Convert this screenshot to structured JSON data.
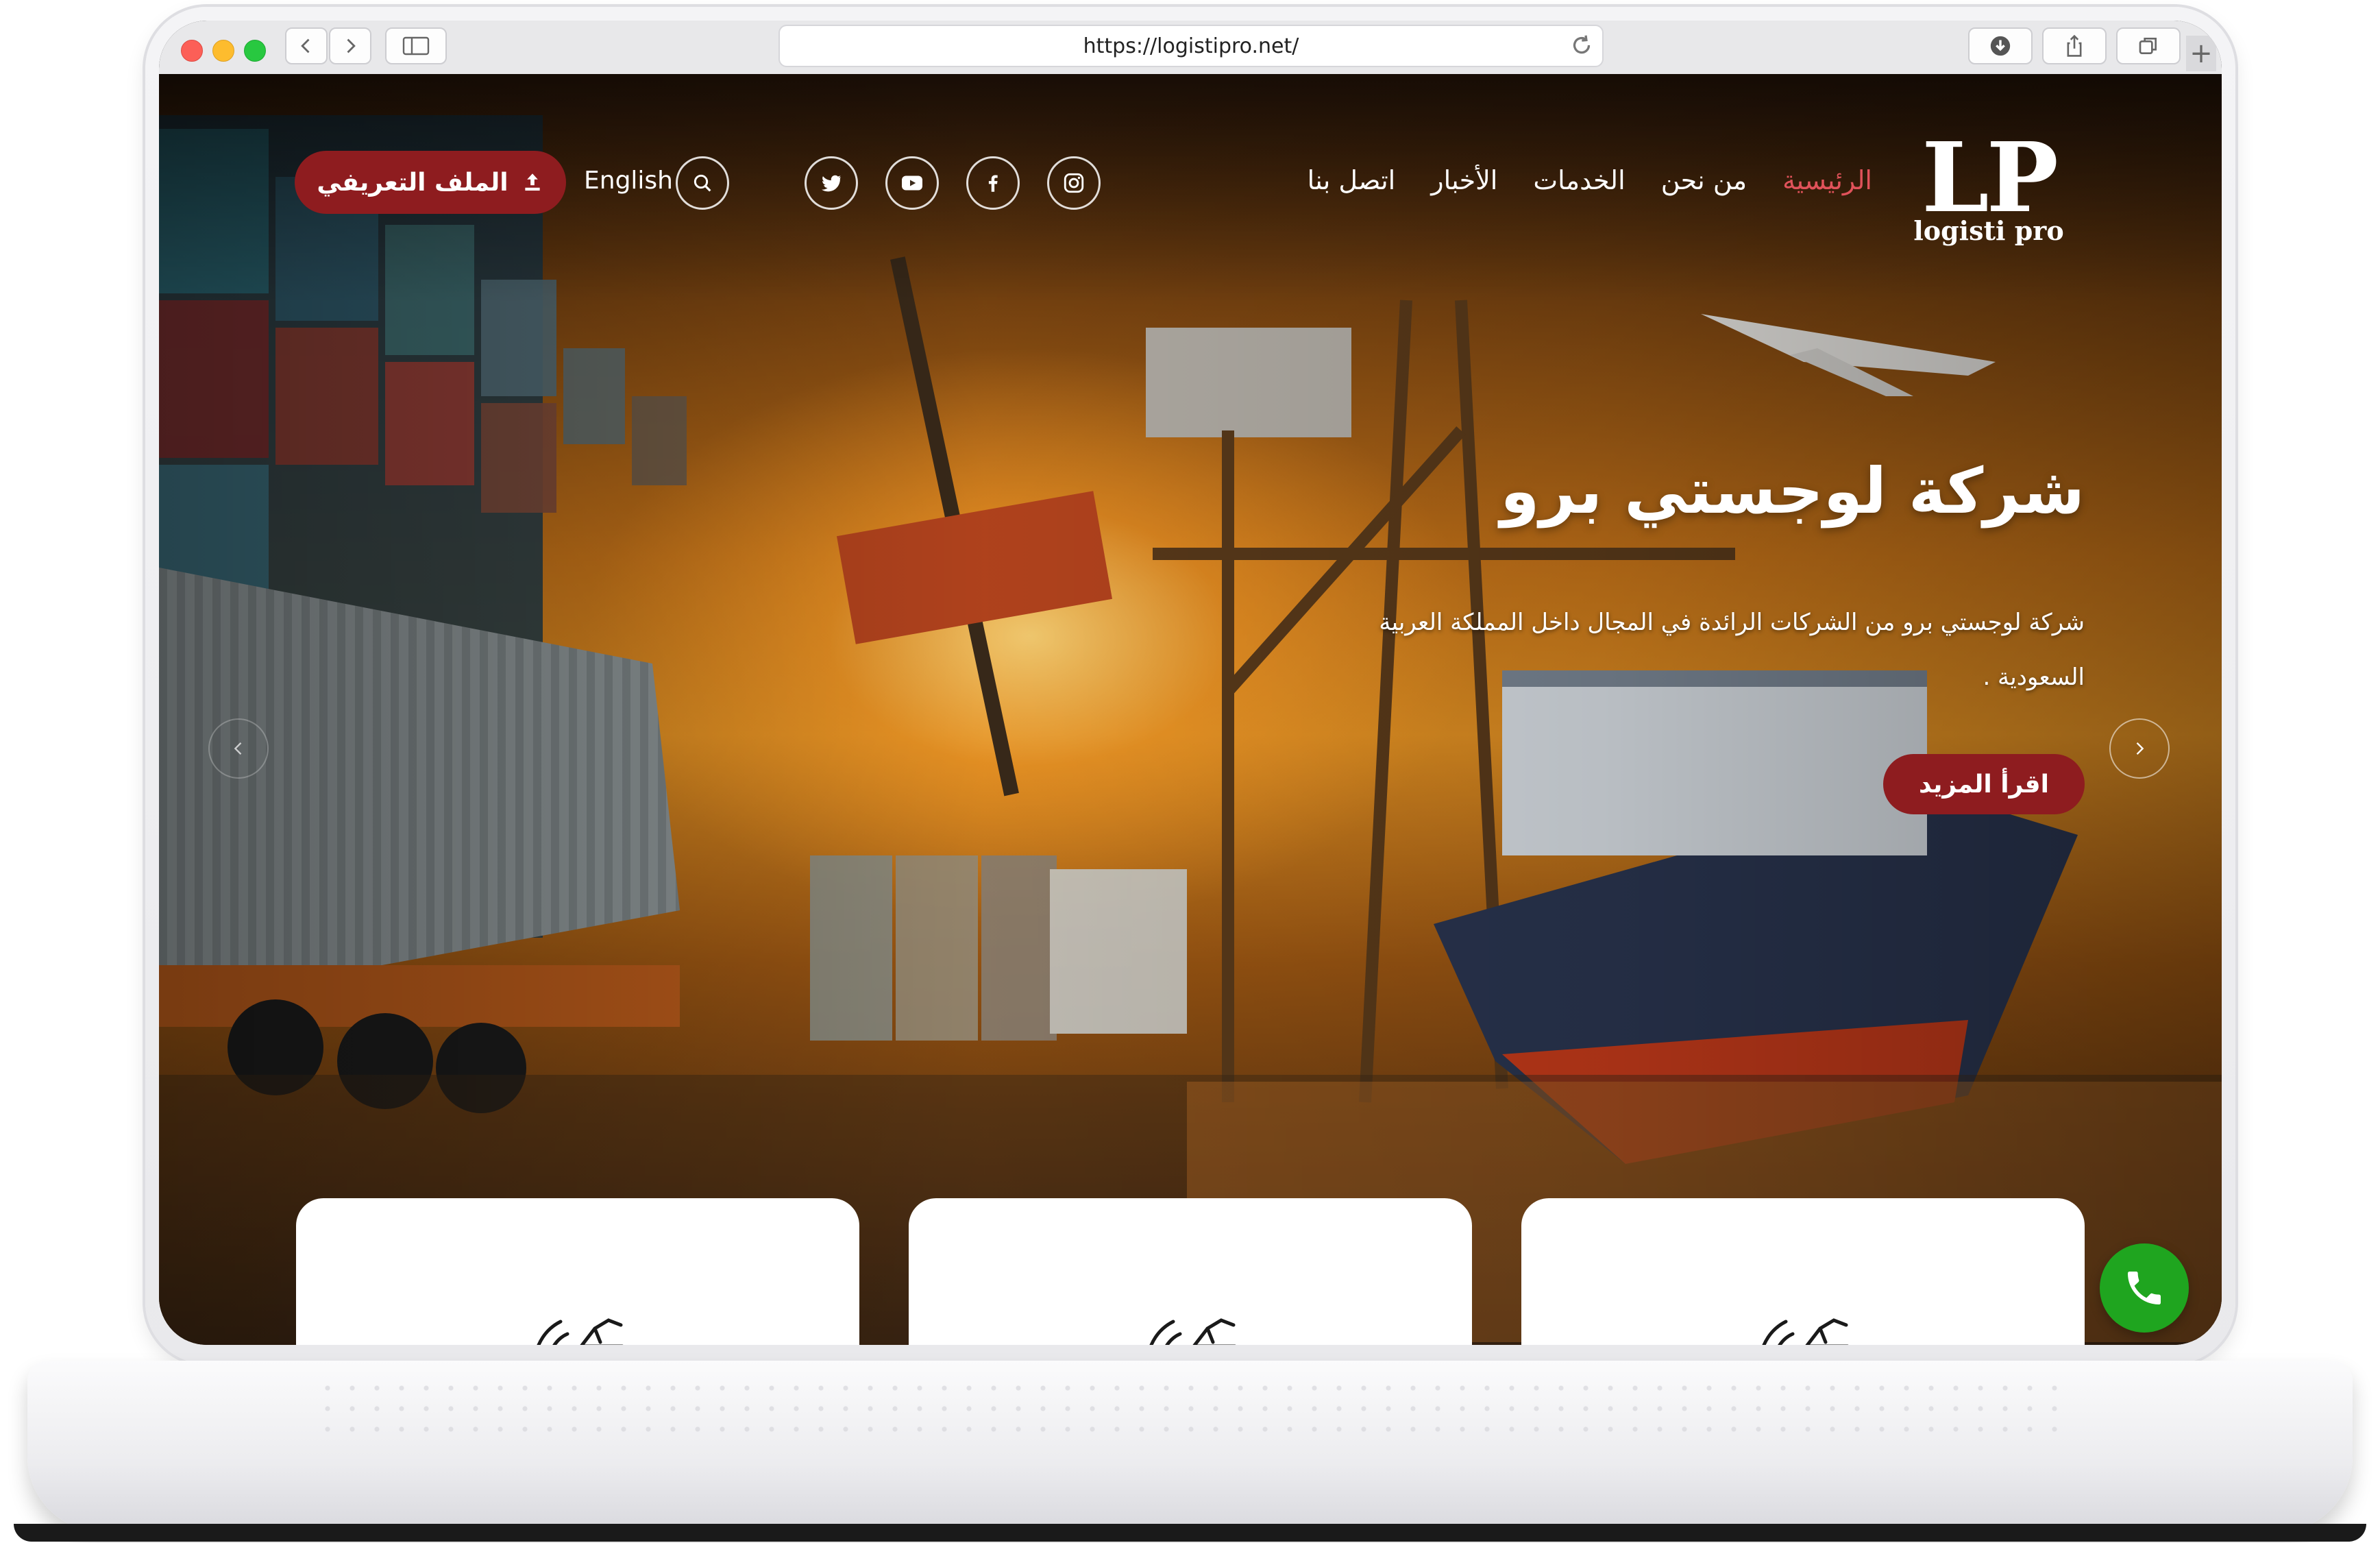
{
  "browser": {
    "url": "https://logistipro.net/"
  },
  "site": {
    "logo_mark": "LP",
    "logo_sub": "logisti pro",
    "nav": [
      {
        "label": "الرئيسية",
        "active": true
      },
      {
        "label": "من نحن",
        "active": false
      },
      {
        "label": "الخدمات",
        "active": false
      },
      {
        "label": "الأخبار",
        "active": false
      },
      {
        "label": "اتصل بنا",
        "active": false
      }
    ],
    "social_icons": [
      "instagram-icon",
      "facebook-icon",
      "youtube-icon",
      "twitter-icon"
    ],
    "language_label": "English",
    "profile_button_label": "الملف التعريفي",
    "accent_color": "#8e1c1f",
    "active_nav_color": "#e0525a",
    "call_button_color": "#1fa51f"
  },
  "hero": {
    "title": "شركة لوجستي برو",
    "description": "شركة لوجستي برو  من الشركات الرائدة في المجال داخل المملكة العربية السعودية .",
    "read_more_label": "اقرأ المزيد"
  },
  "cards": [
    {
      "icon": "handshake-icon"
    },
    {
      "icon": "handshake-icon"
    },
    {
      "icon": "handshake-icon"
    }
  ]
}
